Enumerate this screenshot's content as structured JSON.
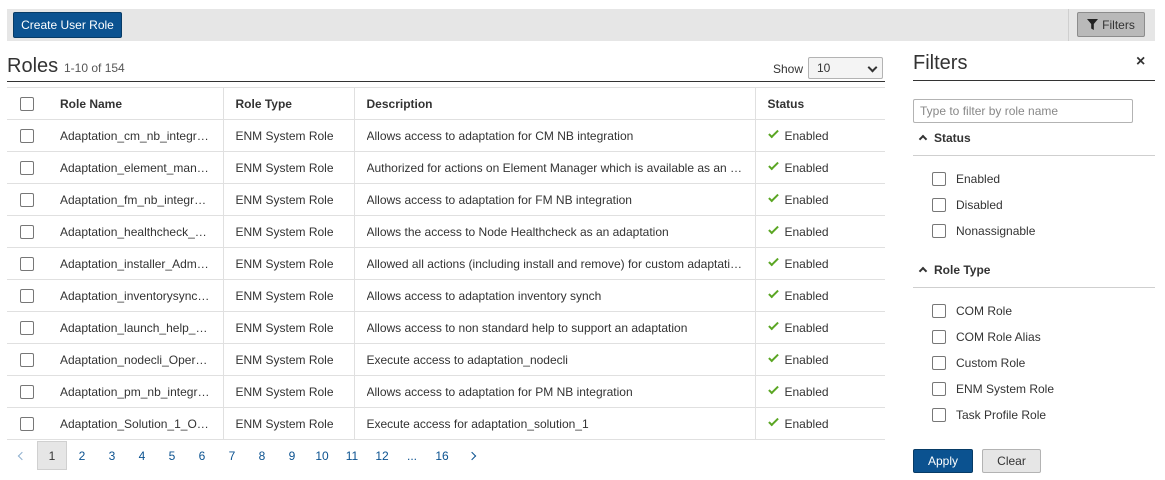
{
  "toolbar": {
    "create_label": "Create User Role",
    "filters_label": "Filters"
  },
  "roles": {
    "title": "Roles",
    "count": "1-10 of 154",
    "show_label": "Show",
    "show_value": "10"
  },
  "table": {
    "columns": [
      "Role Name",
      "Role Type",
      "Description",
      "Status"
    ],
    "rows": [
      {
        "name": "Adaptation_cm_nb_integr…",
        "type": "ENM System Role",
        "description": "Allows access to adaptation for CM NB integration",
        "status": "Enabled"
      },
      {
        "name": "Adaptation_element_man…",
        "type": "ENM System Role",
        "description": "Authorized for actions on Element Manager which is available as an …",
        "status": "Enabled"
      },
      {
        "name": "Adaptation_fm_nb_integr…",
        "type": "ENM System Role",
        "description": "Allows access to adaptation for FM NB integration",
        "status": "Enabled"
      },
      {
        "name": "Adaptation_healthcheck_…",
        "type": "ENM System Role",
        "description": "Allows the access to Node Healthcheck as an adaptation",
        "status": "Enabled"
      },
      {
        "name": "Adaptation_installer_Adm…",
        "type": "ENM System Role",
        "description": "Allowed all actions (including install and remove) for custom adaptati…",
        "status": "Enabled"
      },
      {
        "name": "Adaptation_inventorysync…",
        "type": "ENM System Role",
        "description": "Allows access to adaptation inventory synch",
        "status": "Enabled"
      },
      {
        "name": "Adaptation_launch_help_…",
        "type": "ENM System Role",
        "description": "Allows access to non standard help to support an adaptation",
        "status": "Enabled"
      },
      {
        "name": "Adaptation_nodecli_Oper…",
        "type": "ENM System Role",
        "description": "Execute access to adaptation_nodecli",
        "status": "Enabled"
      },
      {
        "name": "Adaptation_pm_nb_integr…",
        "type": "ENM System Role",
        "description": "Allows access to adaptation for PM NB integration",
        "status": "Enabled"
      },
      {
        "name": "Adaptation_Solution_1_O…",
        "type": "ENM System Role",
        "description": "Execute access for adaptation_solution_1",
        "status": "Enabled"
      }
    ]
  },
  "pagination": {
    "pages": [
      "1",
      "2",
      "3",
      "4",
      "5",
      "6",
      "7",
      "8",
      "9",
      "10",
      "11",
      "12",
      "...",
      "16"
    ],
    "active": "1"
  },
  "filters": {
    "title": "Filters",
    "close_icon": "×",
    "search_placeholder": "Type to filter by role name",
    "status_heading": "Status",
    "status_options": [
      "Enabled",
      "Disabled",
      "Nonassignable"
    ],
    "roletype_heading": "Role Type",
    "roletype_options": [
      "COM Role",
      "COM Role Alias",
      "Custom Role",
      "ENM System Role",
      "Task Profile Role"
    ],
    "apply_label": "Apply",
    "clear_label": "Clear"
  },
  "colors": {
    "primary": "#0b5290",
    "success": "#5aa623",
    "toolbar_bg": "#e6e6e6"
  }
}
